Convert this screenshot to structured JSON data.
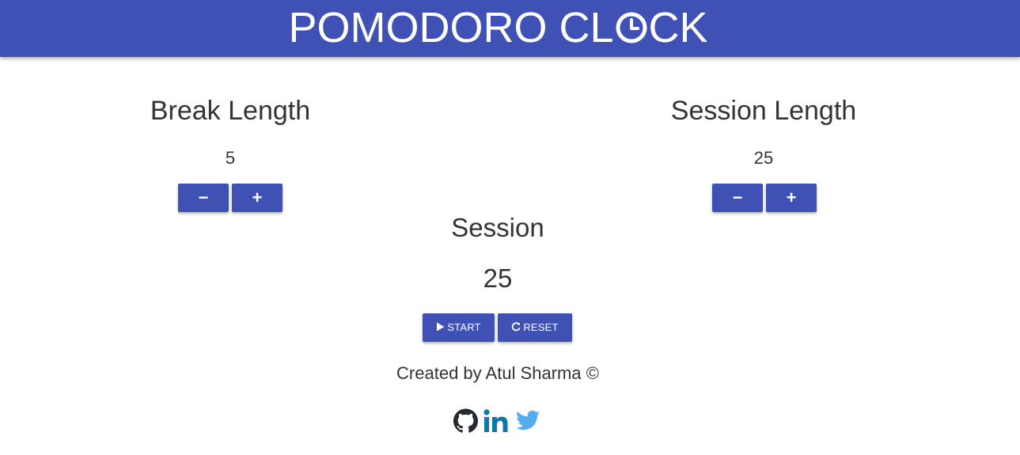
{
  "header": {
    "title_before": "POMODORO CL",
    "title_after": "CK",
    "title_icon": "clock-icon",
    "bg_color": "#3f51b5"
  },
  "break_panel": {
    "heading": "Break Length",
    "value": "5",
    "decrement_label": "−",
    "increment_label": "+"
  },
  "session_panel": {
    "heading": "Session Length",
    "value": "25",
    "decrement_label": "−",
    "increment_label": "+"
  },
  "timer": {
    "label": "Session",
    "time": "25"
  },
  "controls": {
    "start_label": "START",
    "start_icon": "play-icon",
    "reset_label": "RESET",
    "reset_icon": "refresh-icon"
  },
  "footer": {
    "credit": "Created by Atul Sharma ©",
    "social": [
      {
        "name": "github-icon",
        "color": "#24292e"
      },
      {
        "name": "linkedin-icon",
        "color": "#0e76a8"
      },
      {
        "name": "twitter-icon",
        "color": "#55acee"
      }
    ]
  },
  "colors": {
    "accent": "#3f51b5",
    "text": "#333333"
  }
}
